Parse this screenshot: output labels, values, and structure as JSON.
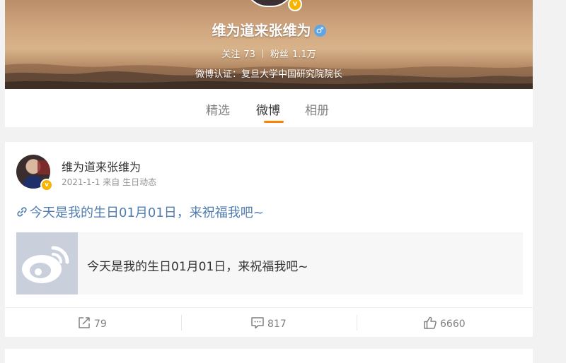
{
  "profile": {
    "name": "维为道来张维为",
    "gender_symbol": "♂",
    "following_label": "关注",
    "following_count": "73",
    "followers_label": "粉丝",
    "followers_count": "1.1万",
    "verified_text": "微博认证：复旦大学中国研究院院长",
    "verify_symbol": "v"
  },
  "tabs": [
    {
      "label": "精选",
      "active": false
    },
    {
      "label": "微博",
      "active": true
    },
    {
      "label": "相册",
      "active": false
    }
  ],
  "post": {
    "author": "维为道来张维为",
    "date": "2021-1-1",
    "source": "来自 生日动态",
    "text": "今天是我的生日01月01日，来祝福我吧~",
    "link_card_title": "今天是我的生日01月01日，来祝福我吧~",
    "verify_symbol": "v",
    "actions": {
      "repost_count": "79",
      "comment_count": "817",
      "like_count": "6660"
    }
  },
  "colors": {
    "accent": "#ff8200",
    "link": "#507daf",
    "verified": "#f7b500"
  },
  "icons": [
    "link-icon",
    "repost-icon",
    "comment-icon",
    "like-icon",
    "weibo-logo-icon",
    "male-icon",
    "verified-icon"
  ]
}
